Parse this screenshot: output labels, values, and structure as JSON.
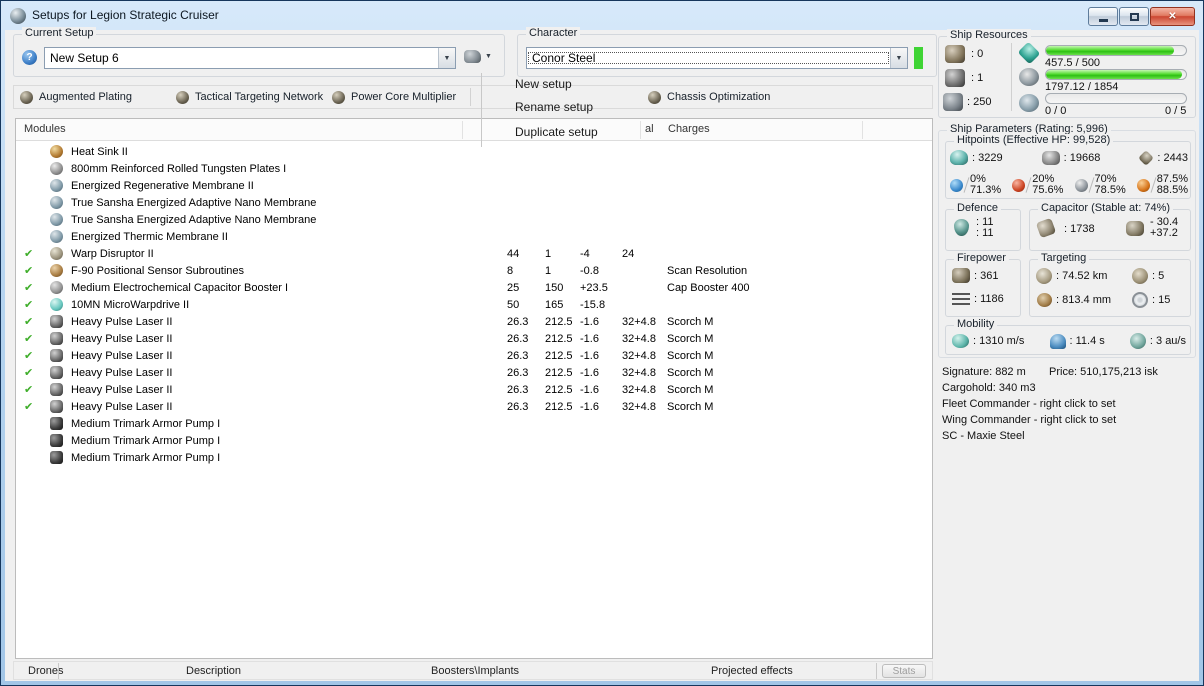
{
  "window": {
    "title": "Setups for Legion Strategic Cruiser"
  },
  "colors": {
    "bar_green": "#3fd42c",
    "character_status_green": "#3fd434",
    "check_green": "#3fae2a",
    "close_button_red": "#cc4631"
  },
  "header": {
    "current_setup_label": "Current Setup",
    "current_setup_value": "New Setup 6",
    "character_label": "Character",
    "character_value": "Conor Steel"
  },
  "subsystems": [
    "Augmented Plating",
    "Tactical Targeting Network",
    "Power Core Multiplier",
    "Chassis Optimization"
  ],
  "setup_menu": {
    "items": [
      "New setup",
      "Rename setup",
      "Duplicate setup"
    ]
  },
  "modules_table": {
    "header_modules": "Modules",
    "header_partial": "al",
    "header_charges": "Charges",
    "check_glyph": "✔",
    "rows": [
      {
        "active": false,
        "icon": "heat-sink-icon",
        "name": "Heat Sink II",
        "c1": "",
        "c2": "",
        "c3": "",
        "c4": "",
        "charge": ""
      },
      {
        "active": false,
        "icon": "armor-plate-icon",
        "name": "800mm Reinforced Rolled Tungsten Plates I",
        "c1": "",
        "c2": "",
        "c3": "",
        "c4": "",
        "charge": ""
      },
      {
        "active": false,
        "icon": "membrane-icon",
        "name": "Energized Regenerative Membrane II",
        "c1": "",
        "c2": "",
        "c3": "",
        "c4": "",
        "charge": ""
      },
      {
        "active": false,
        "icon": "membrane-icon",
        "name": "True Sansha Energized Adaptive Nano Membrane",
        "c1": "",
        "c2": "",
        "c3": "",
        "c4": "",
        "charge": ""
      },
      {
        "active": false,
        "icon": "membrane-icon",
        "name": "True Sansha Energized Adaptive Nano Membrane",
        "c1": "",
        "c2": "",
        "c3": "",
        "c4": "",
        "charge": ""
      },
      {
        "active": false,
        "icon": "membrane-icon",
        "name": "Energized Thermic Membrane II",
        "c1": "",
        "c2": "",
        "c3": "",
        "c4": "",
        "charge": ""
      },
      {
        "active": true,
        "icon": "warp-disruptor-icon",
        "name": "Warp Disruptor II",
        "c1": "44",
        "c2": "1",
        "c3": "-4",
        "c4": "24",
        "charge": ""
      },
      {
        "active": true,
        "icon": "sensor-subroutines-icon",
        "name": "F-90 Positional Sensor Subroutines",
        "c1": "8",
        "c2": "1",
        "c3": "-0.8",
        "c4": "",
        "charge": "Scan Resolution"
      },
      {
        "active": true,
        "icon": "cap-booster-icon",
        "name": "Medium Electrochemical Capacitor Booster I",
        "c1": "25",
        "c2": "150",
        "c3": "+23.5",
        "c4": "",
        "charge": "Cap Booster 400"
      },
      {
        "active": true,
        "icon": "mwd-icon",
        "name": "10MN MicroWarpdrive II",
        "c1": "50",
        "c2": "165",
        "c3": "-15.8",
        "c4": "",
        "charge": ""
      },
      {
        "active": true,
        "icon": "pulse-laser-icon",
        "name": "Heavy Pulse Laser II",
        "c1": "26.3",
        "c2": "212.5",
        "c3": "-1.6",
        "c4": "32+4.8",
        "charge": "Scorch M"
      },
      {
        "active": true,
        "icon": "pulse-laser-icon",
        "name": "Heavy Pulse Laser II",
        "c1": "26.3",
        "c2": "212.5",
        "c3": "-1.6",
        "c4": "32+4.8",
        "charge": "Scorch M"
      },
      {
        "active": true,
        "icon": "pulse-laser-icon",
        "name": "Heavy Pulse Laser II",
        "c1": "26.3",
        "c2": "212.5",
        "c3": "-1.6",
        "c4": "32+4.8",
        "charge": "Scorch M"
      },
      {
        "active": true,
        "icon": "pulse-laser-icon",
        "name": "Heavy Pulse Laser II",
        "c1": "26.3",
        "c2": "212.5",
        "c3": "-1.6",
        "c4": "32+4.8",
        "charge": "Scorch M"
      },
      {
        "active": true,
        "icon": "pulse-laser-icon",
        "name": "Heavy Pulse Laser II",
        "c1": "26.3",
        "c2": "212.5",
        "c3": "-1.6",
        "c4": "32+4.8",
        "charge": "Scorch M"
      },
      {
        "active": true,
        "icon": "pulse-laser-icon",
        "name": "Heavy Pulse Laser II",
        "c1": "26.3",
        "c2": "212.5",
        "c3": "-1.6",
        "c4": "32+4.8",
        "charge": "Scorch M"
      },
      {
        "active": false,
        "icon": "armor-pump-icon",
        "name": "Medium Trimark Armor Pump I",
        "c1": "",
        "c2": "",
        "c3": "",
        "c4": "",
        "charge": ""
      },
      {
        "active": false,
        "icon": "armor-pump-icon",
        "name": "Medium Trimark Armor Pump I",
        "c1": "",
        "c2": "",
        "c3": "",
        "c4": "",
        "charge": ""
      },
      {
        "active": false,
        "icon": "armor-pump-icon",
        "name": "Medium Trimark Armor Pump I",
        "c1": "",
        "c2": "",
        "c3": "",
        "c4": "",
        "charge": ""
      }
    ]
  },
  "bottom": {
    "tabs": [
      "Drones",
      "Description",
      "Boosters\\Implants",
      "Projected effects"
    ],
    "stats_label": "Stats"
  },
  "ship_resources": {
    "title": "Ship Resources",
    "turrets": ": 0",
    "launchers": ": 1",
    "calibration": ": 250",
    "cpu": {
      "text": "457.5 / 500",
      "pct": 91.5
    },
    "powergrid": {
      "text": "1797.12 / 1854",
      "pct": 96.9
    },
    "drones": {
      "text": "0 / 0",
      "right": "0 / 5",
      "pct": 0
    }
  },
  "ship_parameters": {
    "title": "Ship Parameters (Rating: 5,996)",
    "hitpoints": {
      "title": "Hitpoints (Effective HP: 99,528)",
      "shield_hp": ": 3229",
      "armor_hp": ": 19668",
      "structure_hp": ": 2443",
      "resists": [
        {
          "top": "0%",
          "bottom": "71.3%"
        },
        {
          "top": "20%",
          "bottom": "75.6%"
        },
        {
          "top": "70%",
          "bottom": "78.5%"
        },
        {
          "top": "87.5%",
          "bottom": "88.5%"
        }
      ]
    },
    "defence": {
      "title": "Defence",
      "v1": ": 11",
      "v2": ": 11"
    },
    "capacitor": {
      "title": "Capacitor (Stable at: 74%)",
      "amount": ": 1738",
      "out": "- 30.4",
      "in": "+37.2"
    },
    "firepower": {
      "title": "Firepower",
      "dps": ": 361",
      "volley": ": 1186"
    },
    "targeting": {
      "title": "Targeting",
      "range": ": 74.52 km",
      "max_targets": ": 5",
      "scan_res": ": 813.4 mm",
      "sensor_str": ": 15"
    },
    "mobility": {
      "title": "Mobility",
      "speed": ": 1310 m/s",
      "align": ": 11.4 s",
      "warp": ": 3 au/s"
    }
  },
  "summary": {
    "signature": "Signature: 882 m",
    "price": "Price: 510,175,213 isk",
    "cargohold": "Cargohold: 340 m3",
    "fleet_commander": "Fleet Commander - right click to set",
    "wing_commander": "Wing Commander - right click to set",
    "sc": "SC - Maxie Steel"
  }
}
